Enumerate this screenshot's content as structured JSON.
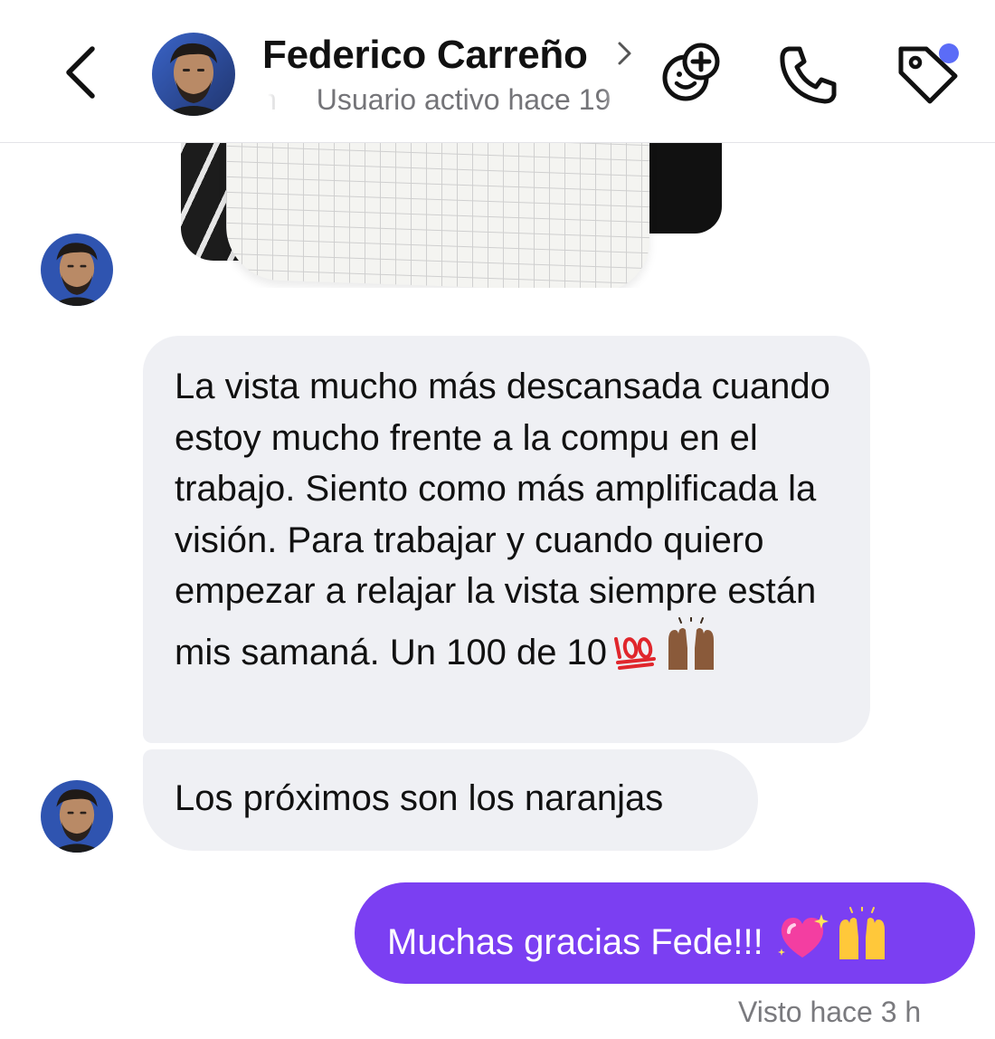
{
  "header": {
    "contact_name": "Federico Carreño",
    "status_ghost": "n",
    "status": "Usuario activo hace 19",
    "unread_dot_color": "#5b6cf7"
  },
  "icons": {
    "back": "chevron-left-icon",
    "name_chevron": "chevron-right-icon",
    "effects": "face-add-icon",
    "call": "phone-icon",
    "tag": "tag-icon"
  },
  "messages": [
    {
      "direction": "incoming",
      "text": "La vista mucho más descansada cuando estoy mucho frente a la compu en el trabajo. Siento como más amplificada la visión. Para trabajar y cuando quiero empezar a relajar la vista siempre están mis samaná. Un 100 de 10",
      "emojis": [
        "hundred-points-emoji",
        "raising-hands-emoji"
      ]
    },
    {
      "direction": "incoming",
      "text": "Los próximos son los naranjas"
    },
    {
      "direction": "outgoing",
      "text": "Muchas gracias Fede!!!",
      "emojis": [
        "sparkling-heart-emoji",
        "raising-hands-emoji"
      ]
    }
  ],
  "seen_status": "Visto hace 3 h",
  "colors": {
    "incoming_bubble": "#eff0f4",
    "outgoing_bubble": "#7b3ff2",
    "text": "#111111",
    "secondary_text": "#7a7a7e"
  }
}
